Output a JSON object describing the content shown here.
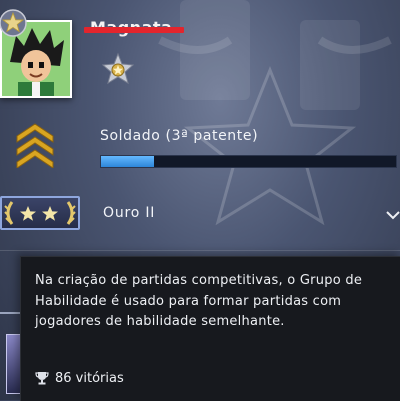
{
  "profile": {
    "username": "Magnata",
    "rank": {
      "label": "Soldado (3ª patente)",
      "progress": 0.18
    },
    "skill_group": {
      "label": "Ouro II"
    }
  },
  "tooltip": {
    "text": "Na criação de partidas competitivas, o Grupo de Habilidade é usado para formar partidas com jogadores de habilidade semelhante.",
    "wins": "86 vitórias"
  },
  "icons": {
    "avatar_badge": "star-icon",
    "medal": "service-medal-icon",
    "rank": "chevron-rank-icon",
    "skill_group": "skill-group-badge-icon",
    "expand": "chevron-down-icon",
    "wins": "trophy-icon"
  },
  "colors": {
    "xp_fill": "#4aa3f2",
    "redaction": "#e3252d",
    "rank_gold": "#d9a521",
    "tooltip_bg": "#17191e"
  }
}
